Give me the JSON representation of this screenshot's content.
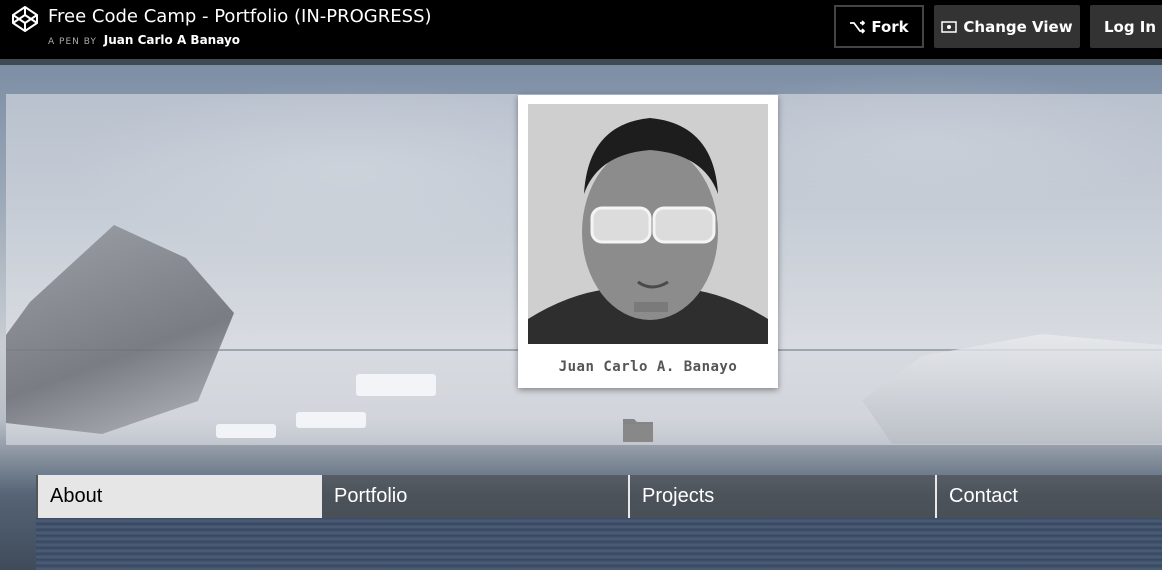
{
  "header": {
    "title": "Free Code Camp - Portfolio (IN-PROGRESS)",
    "byline_prefix": "A PEN BY",
    "author": "Juan Carlo A Banayo",
    "fork_label": "Fork",
    "change_view_label": "Change View",
    "login_label": "Log In"
  },
  "profile": {
    "name": "Juan Carlo A. Banayo"
  },
  "nav": {
    "items": [
      {
        "label": "About",
        "active": true
      },
      {
        "label": "Portfolio",
        "active": false
      },
      {
        "label": "Projects",
        "active": false
      },
      {
        "label": "Contact",
        "active": false
      }
    ]
  },
  "icons": {
    "logo": "codepen-logo-icon",
    "fork": "fork-icon",
    "change_view": "eye-icon",
    "folder": "folder-icon"
  },
  "colors": {
    "topbar_bg": "#000000",
    "button_bg": "#333333",
    "nav_active_bg": "#e6e6e6"
  }
}
